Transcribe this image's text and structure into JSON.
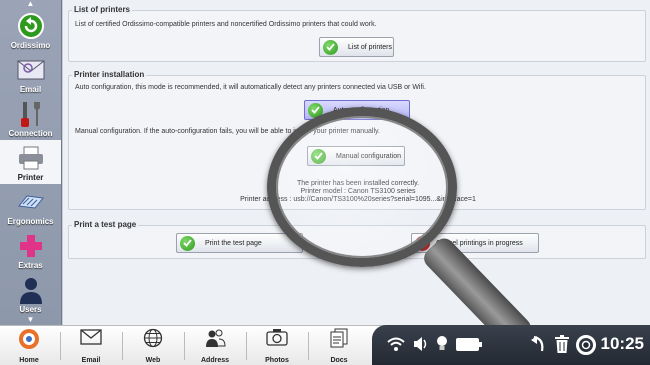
{
  "sidebar": {
    "items": [
      {
        "label": "Ordissimo"
      },
      {
        "label": "Email"
      },
      {
        "label": "Connection"
      },
      {
        "label": "Printer"
      },
      {
        "label": "Ergonomics"
      },
      {
        "label": "Extras"
      },
      {
        "label": "Users"
      }
    ]
  },
  "list_section": {
    "title": "List of printers",
    "description": "List of certified Ordissimo-compatible printers and noncertified Ordissimo printers that could work.",
    "button": "List of printers"
  },
  "install_section": {
    "title": "Printer installation",
    "auto_desc": "Auto configuration, this mode is recommended, it will automatically detect any printers connected via USB or Wifi.",
    "auto_button": "Auto configuration",
    "manual_desc": "Manual configuration. If the auto-configuration fails, you will be able to install your printer manually.",
    "manual_button": "Manual configuration",
    "status_line1": "The printer has been installed correctly.",
    "status_line2": "Printer model : Canon TS3100 series",
    "status_line3": "Printer address : usb://Canon/TS3100%20series?serial=1095...&interface=1"
  },
  "test_section": {
    "title": "Print a test page",
    "print_button": "Print the test page",
    "cancel_button": "Cancel printings in progress"
  },
  "taskbar": {
    "items": [
      {
        "label": "Home"
      },
      {
        "label": "Email"
      },
      {
        "label": "Web"
      },
      {
        "label": "Address"
      },
      {
        "label": "Photos"
      },
      {
        "label": "Docs"
      }
    ],
    "clock": "10:25"
  },
  "colors": {
    "accent_green": "#2e9a1d",
    "focus_blue": "#b7b7f5",
    "cancel_red": "#c21818"
  }
}
